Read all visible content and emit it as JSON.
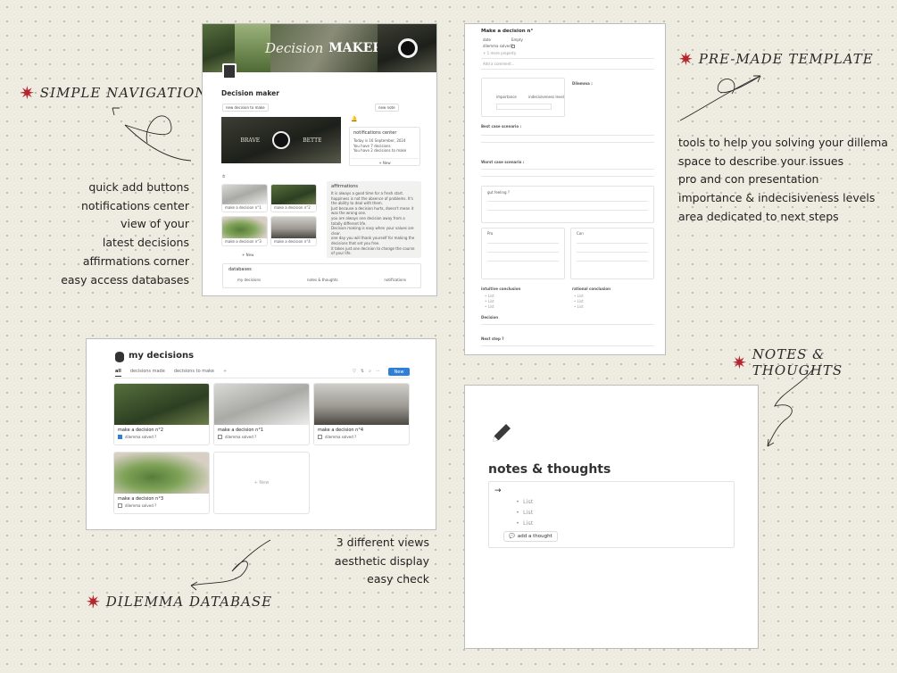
{
  "callouts": {
    "simple_navigation": "SIMPLE NAVIGATION",
    "premade_template": "PRE-MADE TEMPLATE",
    "notes_thoughts": "NOTES & THOUGHTS",
    "dilemma_database": "DILEMMA DATABASE"
  },
  "left_features": [
    "quick add buttons",
    "notifications center",
    "view of your",
    "latest decisions",
    "affirmations corner",
    "easy access databases"
  ],
  "right_features": [
    "tools to help you solving your dillema",
    "space to describe your issues",
    "pro and con presentation",
    "importance & indecisiveness levels",
    "area dedicated to next steps"
  ],
  "bottom_features": [
    "3 different views",
    "aesthetic display",
    "easy check"
  ],
  "maker": {
    "banner_left": "Decision",
    "banner_right": "MAKER",
    "title": "Decision maker",
    "new_decision_btn": "new decision to make",
    "new_note_btn": "new note",
    "image_text_left": "BRAVE",
    "image_text_right": "BETTE",
    "notifications_title": "notifications center",
    "notifications": [
      "Today is 16 September, 2024",
      "You have 7 decisions",
      "You have 2 decisions to make"
    ],
    "notif_new": "+ New",
    "decisions": [
      "make a decision n°1",
      "make a decision n°2",
      "make a decision n°3",
      "make a decision n°4"
    ],
    "new_label": "+ New",
    "affirmations_title": "affirmations",
    "affirmations": [
      "It is always a good time for a fresh start.",
      "happiness is not the absence of problems. It's the ability to deal with them.",
      "Just because a decision hurts, doesn't mean it was the wrong one.",
      "you are always one decision away from a totally different life.",
      "Decision making is easy when your values are clear.",
      "one day you will thank yourself for making the decisions that set you free.",
      "it takes just one decision to change the course of your life."
    ],
    "databases_title": "databases",
    "databases": [
      "my decisions",
      "notes & thoughts",
      "notifications"
    ]
  },
  "template": {
    "title": "Make a decision n°",
    "props": [
      "date",
      "dilemma solved?",
      "+ 1 more property"
    ],
    "prop_values": [
      "Empty",
      ""
    ],
    "add_comment": "Add a comment...",
    "importance": "importance",
    "indecisiveness": "indecisiveness level",
    "dilemma": "Dilemma :",
    "best_case": "Best case scenario :",
    "worst_case": "Worst case scenario :",
    "gut_feeling": "gut feeling ?",
    "pro": "Pro",
    "con": "Con",
    "intuitive": "intuitive conclusion",
    "rational": "rational conclusion",
    "list_item": "List",
    "decision": "Decision",
    "next_step": "Next step ?"
  },
  "database": {
    "title": "my decisions",
    "views": [
      "all",
      "decisions made",
      "decisions to make"
    ],
    "new_button": "New",
    "cards": [
      {
        "title": "make a decision n°2",
        "check": "dilemma solved ?",
        "checked": true
      },
      {
        "title": "make a decision n°1",
        "check": "dilemma solved ?",
        "checked": false
      },
      {
        "title": "make a decision n°4",
        "check": "dilemma solved ?",
        "checked": false
      },
      {
        "title": "make a decision n°3",
        "check": "dilemma solved ?",
        "checked": false
      }
    ],
    "new_card": "+ New"
  },
  "notes": {
    "title": "notes & thoughts",
    "arrow": "→",
    "items": [
      "List",
      "List",
      "List"
    ],
    "add_button": "add a thought"
  }
}
